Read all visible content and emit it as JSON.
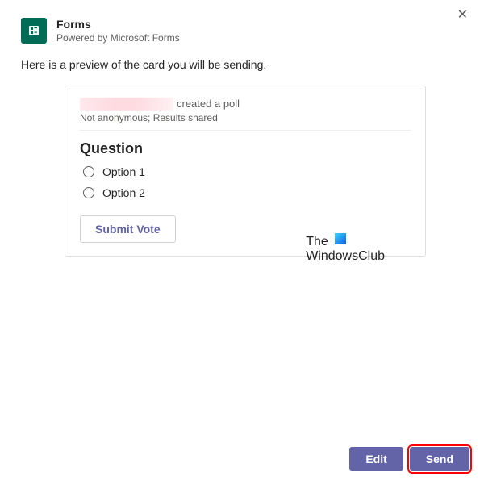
{
  "header": {
    "app_title": "Forms",
    "app_subtitle": "Powered by Microsoft Forms"
  },
  "preview_text": "Here is a preview of the card you will be sending.",
  "poll": {
    "created_suffix": "created a poll",
    "meta": "Not anonymous; Results shared",
    "question": "Question",
    "options": [
      {
        "label": "Option 1"
      },
      {
        "label": "Option 2"
      }
    ],
    "submit_label": "Submit Vote"
  },
  "footer": {
    "edit_label": "Edit",
    "send_label": "Send"
  },
  "watermark": {
    "line1": "The",
    "line2": "WindowsClub"
  }
}
